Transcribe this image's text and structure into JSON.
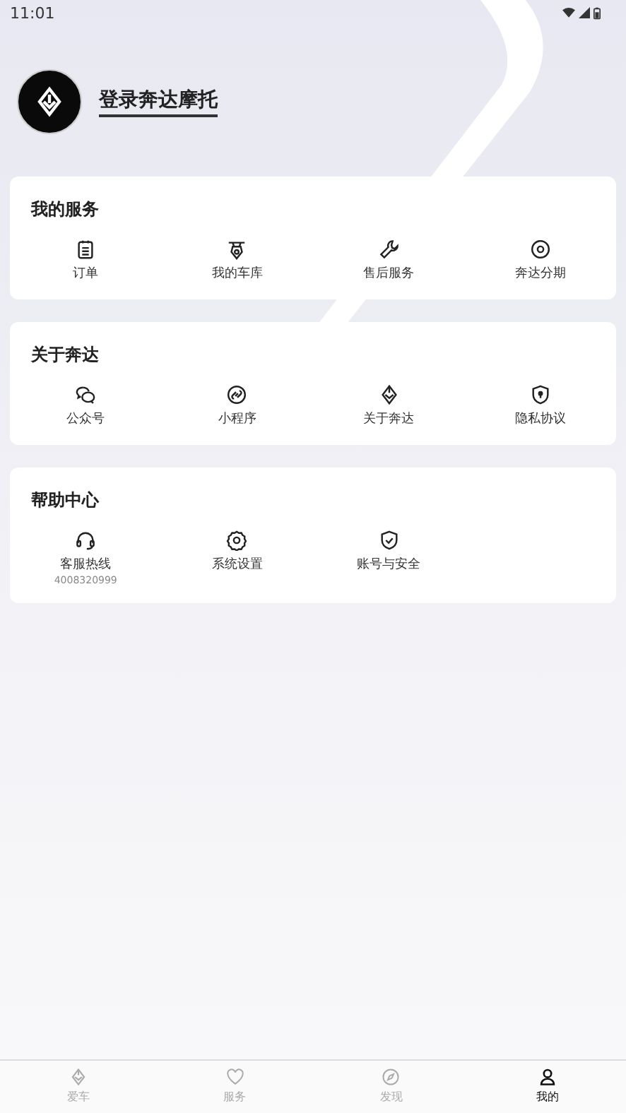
{
  "status_bar": {
    "time": "11:01"
  },
  "profile": {
    "login_label": "登录奔达摩托"
  },
  "sections": [
    {
      "title": "我的服务",
      "items": [
        {
          "label": "订单"
        },
        {
          "label": "我的车库"
        },
        {
          "label": "售后服务"
        },
        {
          "label": "奔达分期"
        }
      ]
    },
    {
      "title": "关于奔达",
      "items": [
        {
          "label": "公众号"
        },
        {
          "label": "小程序"
        },
        {
          "label": "关于奔达"
        },
        {
          "label": "隐私协议"
        }
      ]
    },
    {
      "title": "帮助中心",
      "items": [
        {
          "label": "客服热线",
          "sub": "4008320999"
        },
        {
          "label": "系统设置"
        },
        {
          "label": "账号与安全"
        }
      ]
    }
  ],
  "tab_bar": [
    {
      "label": "爱车",
      "selected": false
    },
    {
      "label": "服务",
      "selected": false
    },
    {
      "label": "发现",
      "selected": false
    },
    {
      "label": "我的",
      "selected": true
    }
  ]
}
